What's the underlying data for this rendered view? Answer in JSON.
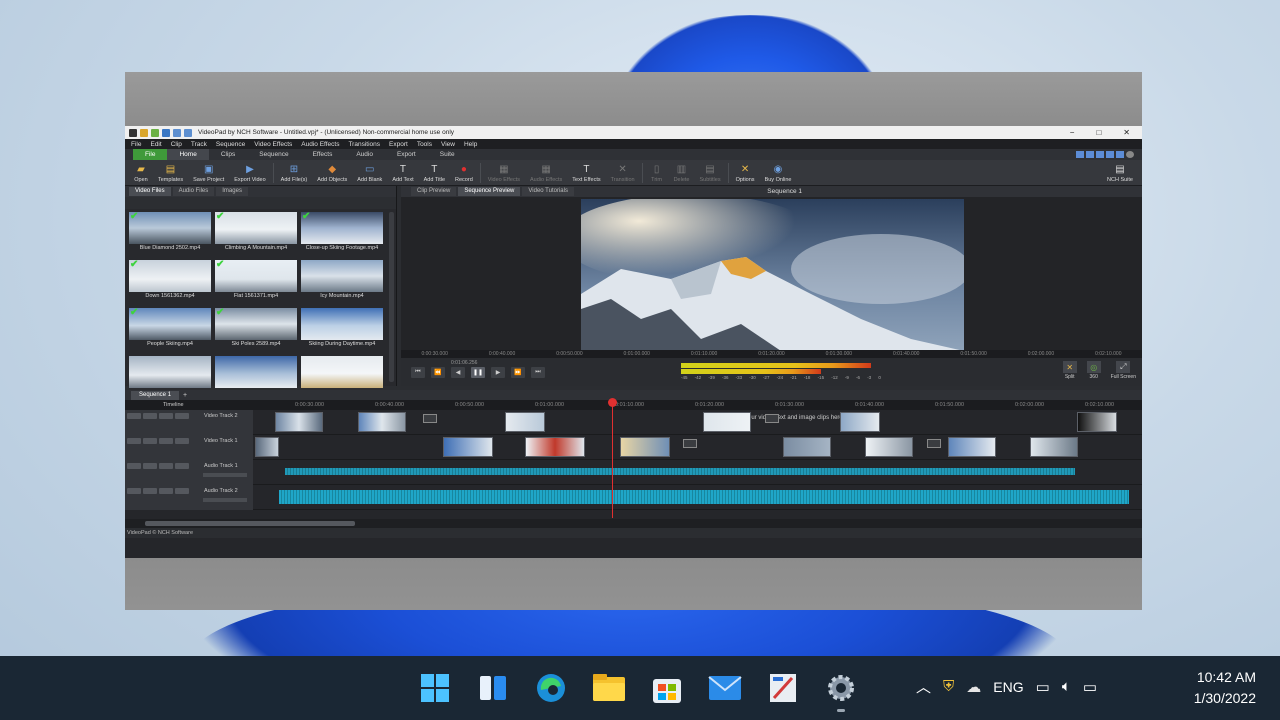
{
  "window": {
    "title": "VideoPad by NCH Software - Untitled.vpj* - (Unlicensed) Non-commercial home use only"
  },
  "menu": [
    "File",
    "Edit",
    "Clip",
    "Track",
    "Sequence",
    "Video Effects",
    "Audio Effects",
    "Transitions",
    "Export",
    "Tools",
    "View",
    "Help"
  ],
  "tabs": [
    "File",
    "Home",
    "Clips",
    "Sequence",
    "Effects",
    "Audio",
    "Export",
    "Suite"
  ],
  "ribbon": [
    {
      "label": "Open",
      "icon": "folder-icon"
    },
    {
      "label": "Templates",
      "icon": "templates-icon"
    },
    {
      "label": "Save Project",
      "icon": "save-icon"
    },
    {
      "label": "Export Video",
      "icon": "export-icon"
    },
    {
      "label": "Add File(s)",
      "icon": "add-file-icon"
    },
    {
      "label": "Add Objects",
      "icon": "objects-icon"
    },
    {
      "label": "Add Blank",
      "icon": "blank-icon"
    },
    {
      "label": "Add Text",
      "icon": "text-icon"
    },
    {
      "label": "Add Title",
      "icon": "title-icon"
    },
    {
      "label": "Record",
      "icon": "record-icon"
    },
    {
      "label": "Video Effects",
      "icon": "video-effects-icon"
    },
    {
      "label": "Audio Effects",
      "icon": "audio-effects-icon"
    },
    {
      "label": "Text Effects",
      "icon": "text-effects-icon"
    },
    {
      "label": "Transition",
      "icon": "transition-icon"
    },
    {
      "label": "Trim",
      "icon": "trim-icon"
    },
    {
      "label": "Delete",
      "icon": "delete-icon"
    },
    {
      "label": "Subtitles",
      "icon": "subtitles-icon"
    },
    {
      "label": "Options",
      "icon": "options-icon"
    },
    {
      "label": "Buy Online",
      "icon": "buy-icon"
    },
    {
      "label": "NCH Suite",
      "icon": "suite-icon"
    }
  ],
  "media": {
    "tabs": [
      "Video Files",
      "Audio Files",
      "Images"
    ],
    "items": [
      {
        "label": "Blue Diamond 2502.mp4"
      },
      {
        "label": "Climbing A Mountain.mp4"
      },
      {
        "label": "Close-up Skiing Footage.mp4"
      },
      {
        "label": "Down 1561362.mp4"
      },
      {
        "label": "Flat 1561371.mp4"
      },
      {
        "label": "Icy Mountain.mp4"
      },
      {
        "label": "People Skiing.mp4"
      },
      {
        "label": "Ski Poles 2589.mp4"
      },
      {
        "label": "Skiing During Daytime.mp4"
      },
      {
        "label": ""
      },
      {
        "label": ""
      },
      {
        "label": ""
      }
    ]
  },
  "preview": {
    "tabs": [
      "Clip Preview",
      "Sequence Preview",
      "Video Tutorials"
    ],
    "title": "Sequence 1",
    "time": "0:01:06.256",
    "ruler": [
      "0:00:30.000",
      "0:00:40.000",
      "0:00:50.000",
      "0:01:00.000",
      "0:01:10.000",
      "0:01:20.000",
      "0:01:30.000",
      "0:01:40.000",
      "0:01:50.000",
      "0:02:00.000",
      "0:02:10.000"
    ],
    "meter_labels": [
      "-45",
      "-42",
      "-39",
      "-36",
      "-33",
      "-30",
      "-27",
      "-24",
      "-21",
      "-18",
      "-15",
      "-12",
      "-9",
      "-6",
      "-3",
      "0"
    ],
    "right_buttons": [
      "Split",
      "360",
      "Full Screen"
    ]
  },
  "timeline": {
    "tab": "Sequence 1",
    "label": "Timeline",
    "hint": "Drag and drop your video, text and image clips here to overlay",
    "ruler": [
      "0:00:30.000",
      "0:00:40.000",
      "0:00:50.000",
      "0:01:00.000",
      "0:01:10.000",
      "0:01:20.000",
      "0:01:30.000",
      "0:01:40.000",
      "0:01:50.000",
      "0:02:00.000",
      "0:02:10.000"
    ],
    "tracks": [
      "Video Track 2",
      "Video Track 1",
      "Audio Track 1",
      "Audio Track 2"
    ]
  },
  "status": "VideoPad © NCH Software",
  "taskbar": {
    "apps": [
      "start-icon",
      "widgets-icon",
      "edge-icon",
      "file-explorer-icon",
      "store-icon",
      "mail-icon",
      "paint-icon",
      "settings-icon"
    ],
    "lang": "ENG",
    "time": "10:42 AM",
    "date": "1/30/2022"
  }
}
